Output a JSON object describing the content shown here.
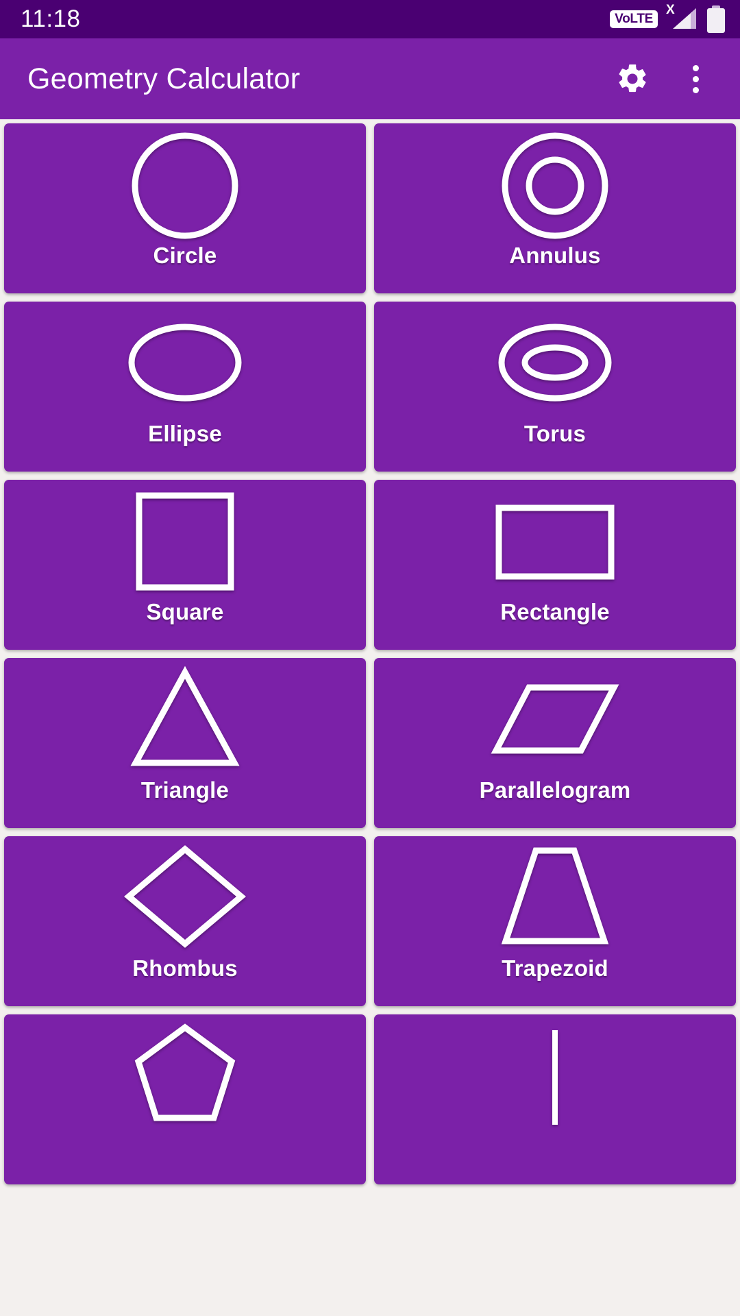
{
  "status_bar": {
    "clock": "11:18",
    "icons": [
      {
        "name": "volte-icon",
        "label": "VoLTE"
      },
      {
        "name": "signal-no-sim-icon",
        "label": "X"
      },
      {
        "name": "battery-icon",
        "label": "battery"
      }
    ]
  },
  "app_bar": {
    "title": "Geometry Calculator",
    "actions": [
      {
        "name": "settings-button",
        "icon": "gear-icon"
      },
      {
        "name": "overflow-menu-button",
        "icon": "more-vertical-icon"
      }
    ]
  },
  "colors": {
    "status_bar": "#4a0072",
    "app_bar": "#7b21a8",
    "card": "#7b21a8",
    "page_background": "#f3f0ee",
    "stroke": "#ffffff",
    "text": "#ffffff"
  },
  "grid": {
    "columns": 2,
    "shapes": [
      {
        "label": "Circle",
        "icon": "circle-shape-icon"
      },
      {
        "label": "Annulus",
        "icon": "annulus-shape-icon"
      },
      {
        "label": "Ellipse",
        "icon": "ellipse-shape-icon"
      },
      {
        "label": "Torus",
        "icon": "torus-shape-icon"
      },
      {
        "label": "Square",
        "icon": "square-shape-icon"
      },
      {
        "label": "Rectangle",
        "icon": "rectangle-shape-icon"
      },
      {
        "label": "Triangle",
        "icon": "triangle-shape-icon"
      },
      {
        "label": "Parallelogram",
        "icon": "parallelogram-shape-icon"
      },
      {
        "label": "Rhombus",
        "icon": "rhombus-shape-icon"
      },
      {
        "label": "Trapezoid",
        "icon": "trapezoid-shape-icon"
      },
      {
        "label": "",
        "icon": "pentagon-shape-icon"
      },
      {
        "label": "",
        "icon": "line-shape-icon"
      }
    ]
  }
}
